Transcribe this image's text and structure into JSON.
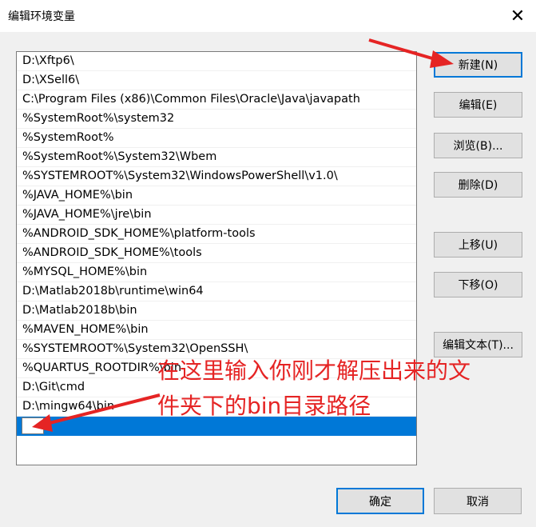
{
  "window": {
    "title": "编辑环境变量",
    "close_glyph": "✕"
  },
  "path_list": {
    "items": [
      "D:\\Xftp6\\",
      "D:\\XSell6\\",
      "C:\\Program Files (x86)\\Common Files\\Oracle\\Java\\javapath",
      "%SystemRoot%\\system32",
      "%SystemRoot%",
      "%SystemRoot%\\System32\\Wbem",
      "%SYSTEMROOT%\\System32\\WindowsPowerShell\\v1.0\\",
      "%JAVA_HOME%\\bin",
      "%JAVA_HOME%\\jre\\bin",
      "%ANDROID_SDK_HOME%\\platform-tools",
      "%ANDROID_SDK_HOME%\\tools",
      "%MYSQL_HOME%\\bin",
      "D:\\Matlab2018b\\runtime\\win64",
      "D:\\Matlab2018b\\bin",
      "%MAVEN_HOME%\\bin",
      "%SYSTEMROOT%\\System32\\OpenSSH\\",
      "%QUARTUS_ROOTDIR%\\bin",
      "D:\\Git\\cmd",
      "D:\\mingw64\\bin"
    ],
    "new_entry_value": "",
    "selection_color": "#0078d7"
  },
  "buttons": {
    "new": "新建(N)",
    "edit": "编辑(E)",
    "browse": "浏览(B)...",
    "delete": "删除(D)",
    "move_up": "上移(U)",
    "move_down": "下移(O)",
    "edit_text": "编辑文本(T)...",
    "ok": "确定",
    "cancel": "取消"
  },
  "annotation": {
    "line1": "在这里输入你刚才解压出来的文",
    "line2": "件夹下的bin目录路径",
    "color": "#e52424"
  }
}
